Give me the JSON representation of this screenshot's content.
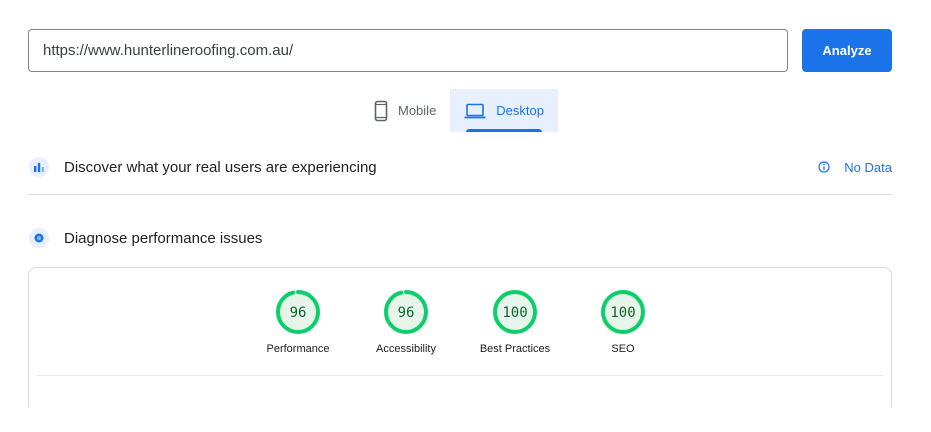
{
  "search": {
    "url_value": "https://www.hunterlineroofing.com.au/"
  },
  "analyze_label": "Analyze",
  "tabs": [
    {
      "label": "Mobile",
      "icon": "smartphone-icon",
      "active": false
    },
    {
      "label": "Desktop",
      "icon": "laptop-icon",
      "active": true
    }
  ],
  "field_data": {
    "title": "Discover what your real users are experiencing",
    "status_label": "No Data",
    "icon": "crux-users-icon"
  },
  "lab_data": {
    "title": "Diagnose performance issues",
    "icon": "lighthouse-icon"
  },
  "scores": [
    {
      "value": "96",
      "label": "Performance",
      "fraction": 0.96
    },
    {
      "value": "96",
      "label": "Accessibility",
      "fraction": 0.96
    },
    {
      "value": "100",
      "label": "Best Practices",
      "fraction": 1.0
    },
    {
      "value": "100",
      "label": "SEO",
      "fraction": 1.0
    }
  ],
  "colors": {
    "accent": "#1a73e8",
    "pass_stroke": "#0cce6b",
    "pass_fill": "#e6f4ea",
    "pass_text": "#0d652d"
  }
}
